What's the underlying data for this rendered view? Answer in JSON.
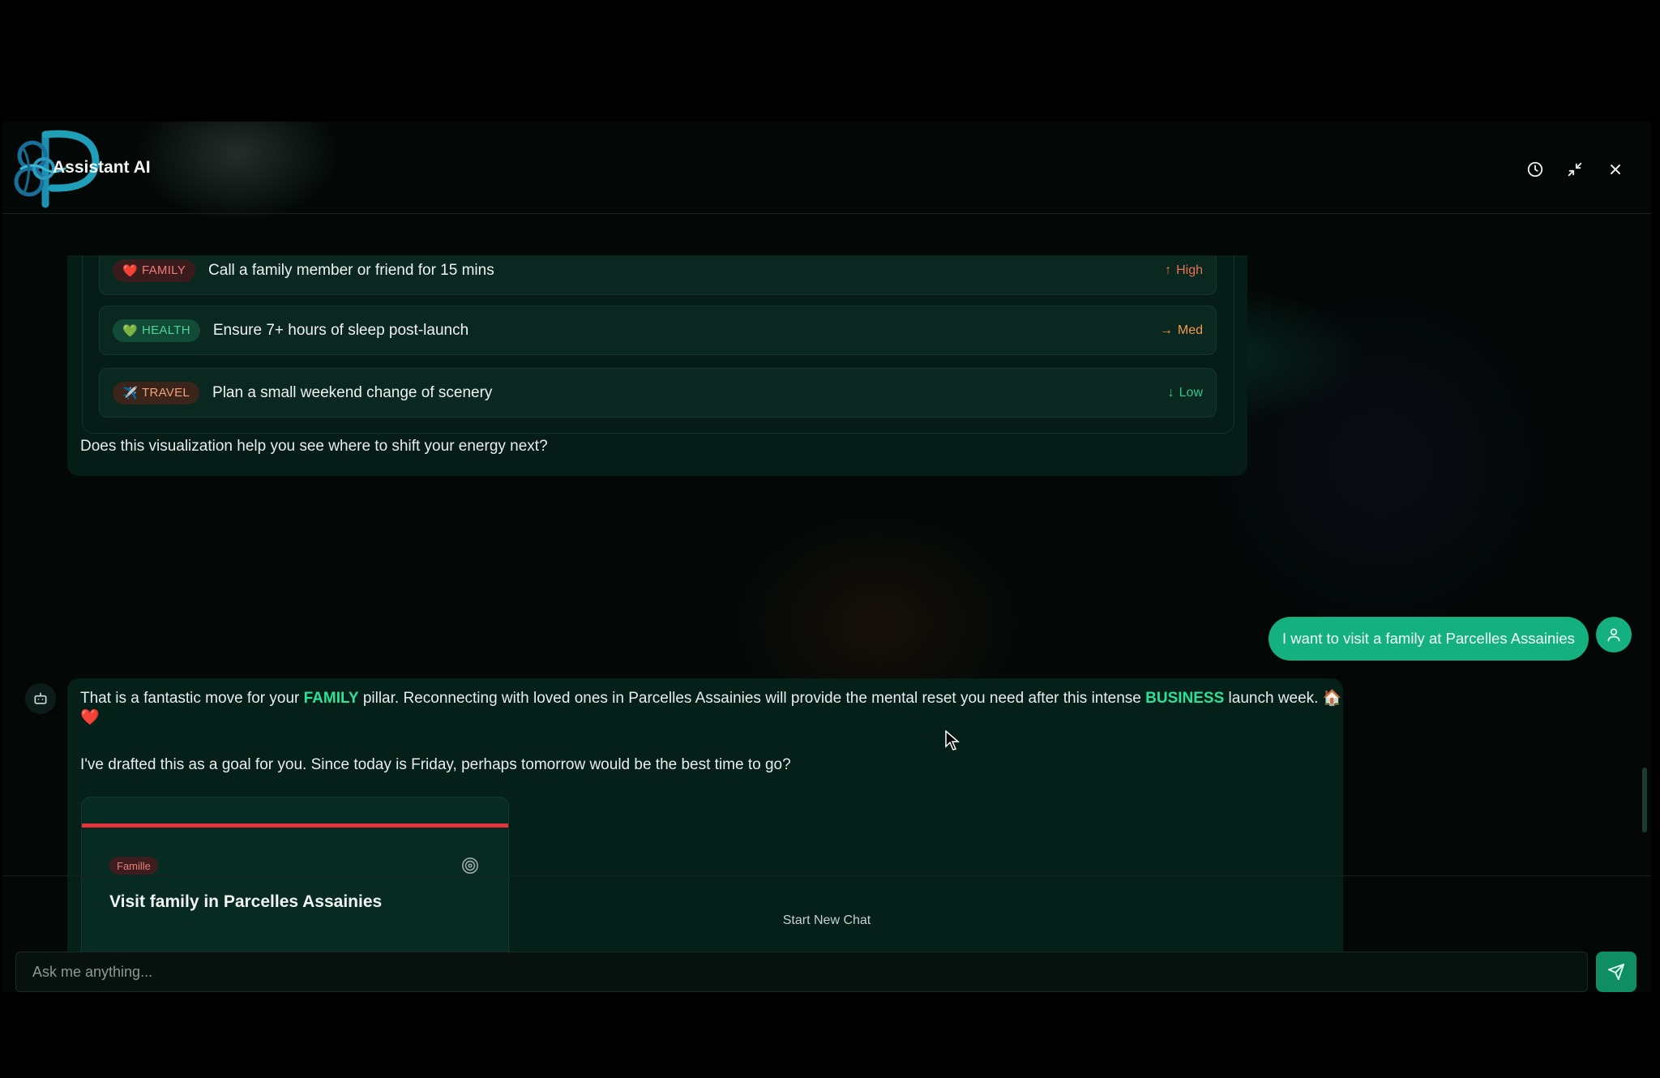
{
  "header": {
    "title": "Assistant AI",
    "icons": [
      "history-icon",
      "minimize-icon",
      "close-icon"
    ]
  },
  "tasks": [
    {
      "tag_icon": "❤️",
      "tag": "FAMILY",
      "text": "Call a family member or friend for 15 mins",
      "priority_arrow": "↑",
      "priority": "High"
    },
    {
      "tag_icon": "💚",
      "tag": "HEALTH",
      "text": "Ensure 7+ hours of sleep post-launch",
      "priority_arrow": "→",
      "priority": "Med"
    },
    {
      "tag_icon": "✈️",
      "tag": "TRAVEL",
      "text": "Plan a small weekend change of scenery",
      "priority_arrow": "↓",
      "priority": "Low"
    }
  ],
  "bot_message_1": {
    "question": "Does this visualization help you see where to shift your energy next?"
  },
  "user_message": {
    "text": "I want to visit a family at Parcelles Assainies"
  },
  "bot_message_2": {
    "p1_a": "That is a fantastic move for your ",
    "p1_hl1": "FAMILY",
    "p1_b": " pillar. Reconnecting with loved ones in Parcelles Assainies will provide the mental reset you need after this intense ",
    "p1_hl2": "BUSINESS",
    "p1_c": " launch week. 🏠❤️",
    "p2": "I've drafted this as a goal for you. Since today is Friday, perhaps tomorrow would be the best time to go?"
  },
  "goal_card": {
    "tag": "Famille",
    "title": "Visit family in Parcelles Assainies",
    "accent_color": "#e8333a"
  },
  "footer": {
    "new_chat": "Start New Chat",
    "input_placeholder": "Ask me anything..."
  },
  "colors": {
    "accent": "#15b07f",
    "highlight": "#2ee09a",
    "background": "#030807"
  }
}
